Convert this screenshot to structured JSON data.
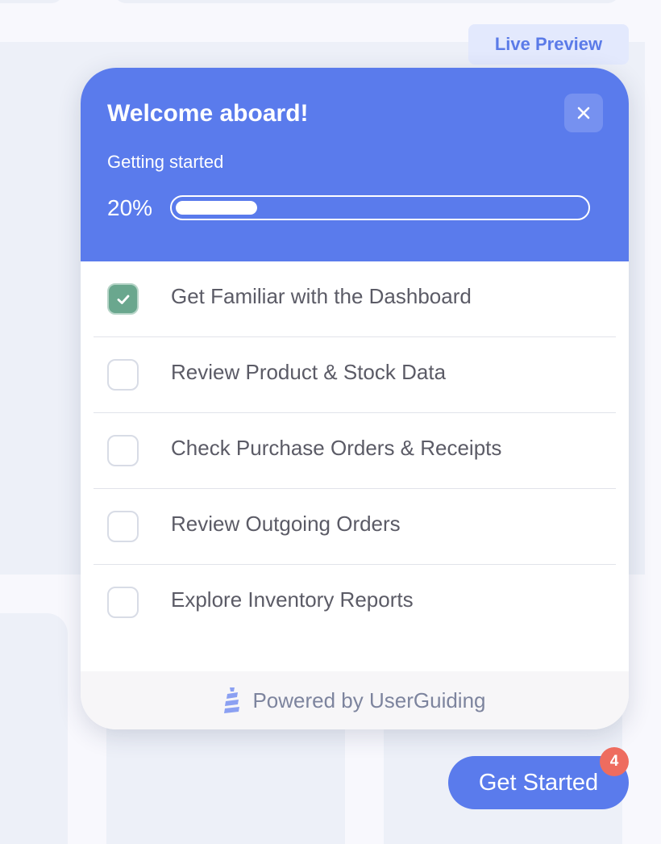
{
  "live_preview": {
    "label": "Live Preview"
  },
  "checklist": {
    "title": "Welcome aboard!",
    "subtitle": "Getting started",
    "progress": {
      "label": "20%",
      "fraction": 0.2
    },
    "tasks": [
      {
        "label": "Get Familiar with the Dashboard",
        "completed": true
      },
      {
        "label": "Review Product & Stock Data",
        "completed": false
      },
      {
        "label": "Check Purchase Orders & Receipts",
        "completed": false
      },
      {
        "label": "Review Outgoing Orders",
        "completed": false
      },
      {
        "label": "Explore Inventory Reports",
        "completed": false
      }
    ],
    "footer": {
      "text": "Powered by UserGuiding"
    }
  },
  "launcher": {
    "label": "Get Started",
    "badge_count": "4"
  },
  "colors": {
    "primary": "#5a7bec",
    "checked": "#6aa78e",
    "badge": "#ee6c5f",
    "preview_bg": "#e3e9fd"
  },
  "icons": {
    "close": "close-icon",
    "check": "check-icon",
    "brand": "userguiding-logo-icon"
  }
}
